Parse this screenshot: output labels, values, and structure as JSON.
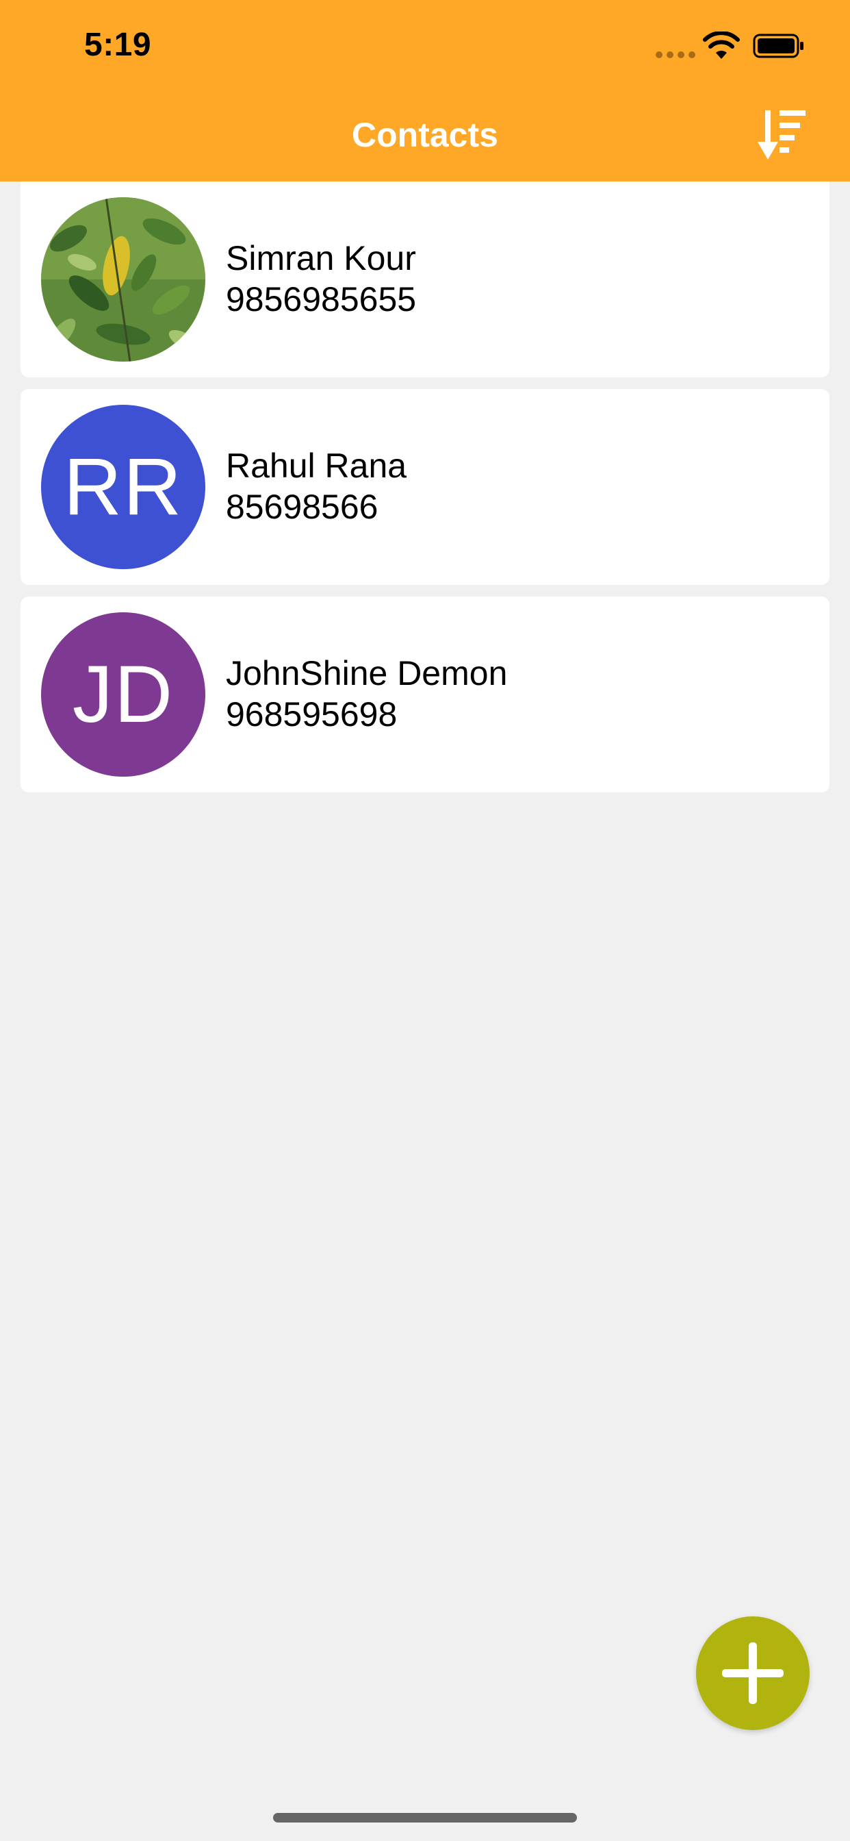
{
  "status_bar": {
    "time": "5:19"
  },
  "header": {
    "title": "Contacts",
    "background": "#FFA726",
    "sort_icon": "sort-descending-icon"
  },
  "contacts": [
    {
      "name": "Simran Kour",
      "phone": "9856985655",
      "avatar": {
        "type": "photo",
        "subject": "green leaves"
      }
    },
    {
      "name": "Rahul Rana",
      "phone": "85698566",
      "avatar": {
        "type": "initials",
        "initials": "RR",
        "color": "#3F51D3"
      }
    },
    {
      "name": "JohnShine Demon",
      "phone": "968595698",
      "avatar": {
        "type": "initials",
        "initials": "JD",
        "color": "#7E3A93"
      }
    }
  ],
  "fab": {
    "icon": "plus-icon",
    "color": "#B1B40F"
  }
}
